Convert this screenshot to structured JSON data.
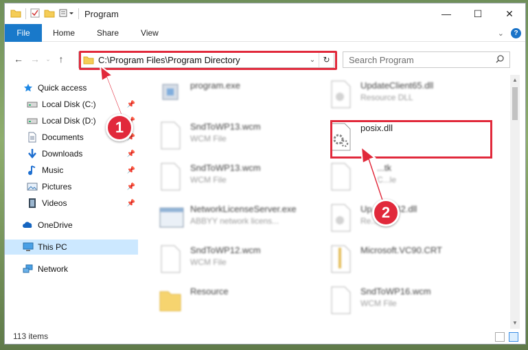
{
  "titlebar": {
    "title": "Program"
  },
  "window_controls": {
    "minimize": "—",
    "maximize": "☐",
    "close": "✕"
  },
  "ribbon": {
    "tabs": [
      "File",
      "Home",
      "Share",
      "View"
    ],
    "help": "?"
  },
  "address": {
    "path": "C:\\Program Files\\Program Directory"
  },
  "search": {
    "placeholder": "Search Program"
  },
  "nav": {
    "items": [
      {
        "label": "Quick access",
        "icon": "star-icon",
        "pinned": false
      },
      {
        "label": "Local Disk (C:)",
        "icon": "drive-icon",
        "pinned": true
      },
      {
        "label": "Local Disk (D:)",
        "icon": "drive-icon",
        "pinned": true
      },
      {
        "label": "Documents",
        "icon": "documents-icon",
        "pinned": true
      },
      {
        "label": "Downloads",
        "icon": "downloads-icon",
        "pinned": true
      },
      {
        "label": "Music",
        "icon": "music-icon",
        "pinned": true
      },
      {
        "label": "Pictures",
        "icon": "pictures-icon",
        "pinned": true
      },
      {
        "label": "Videos",
        "icon": "videos-icon",
        "pinned": true
      },
      {
        "label": "OneDrive",
        "icon": "onedrive-icon",
        "pinned": false
      },
      {
        "label": "This PC",
        "icon": "this-pc-icon",
        "pinned": false
      },
      {
        "label": "Network",
        "icon": "network-icon",
        "pinned": false
      }
    ]
  },
  "files": [
    {
      "name": "program.exe",
      "type": "",
      "icon": "exe-icon"
    },
    {
      "name": "UpdateClient65.dll",
      "type": "Resource DLL",
      "icon": "dll-icon"
    },
    {
      "name": "SndToWP13.wcm",
      "type": "WCM File",
      "icon": "file-icon"
    },
    {
      "name": "posix.dll",
      "type": "",
      "icon": "gear-file-icon"
    },
    {
      "name": "SndToWP13.wcm",
      "type": "WCM File",
      "icon": "file-icon"
    },
    {
      "name": "...tk",
      "type": "C...le",
      "icon": "file-icon"
    },
    {
      "name": "NetworkLicenseServer.exe",
      "type": "ABBYY network licens...",
      "icon": "app-window-icon"
    },
    {
      "name": "Up...lient42.dll",
      "type": "Re...LL",
      "icon": "dll-icon"
    },
    {
      "name": "SndToWP12.wcm",
      "type": "WCM File",
      "icon": "file-icon"
    },
    {
      "name": "Microsoft.VC90.CRT",
      "type": "",
      "icon": "zip-icon"
    },
    {
      "name": "Resource",
      "type": "",
      "icon": "folder-icon"
    },
    {
      "name": "SndToWP16.wcm",
      "type": "WCM File",
      "icon": "file-icon"
    }
  ],
  "status": {
    "item_count": "113 items"
  },
  "annotations": [
    "1",
    "2"
  ],
  "colors": {
    "accent": "#1979ca",
    "highlight": "#e1293b",
    "selected": "#cce8ff"
  }
}
